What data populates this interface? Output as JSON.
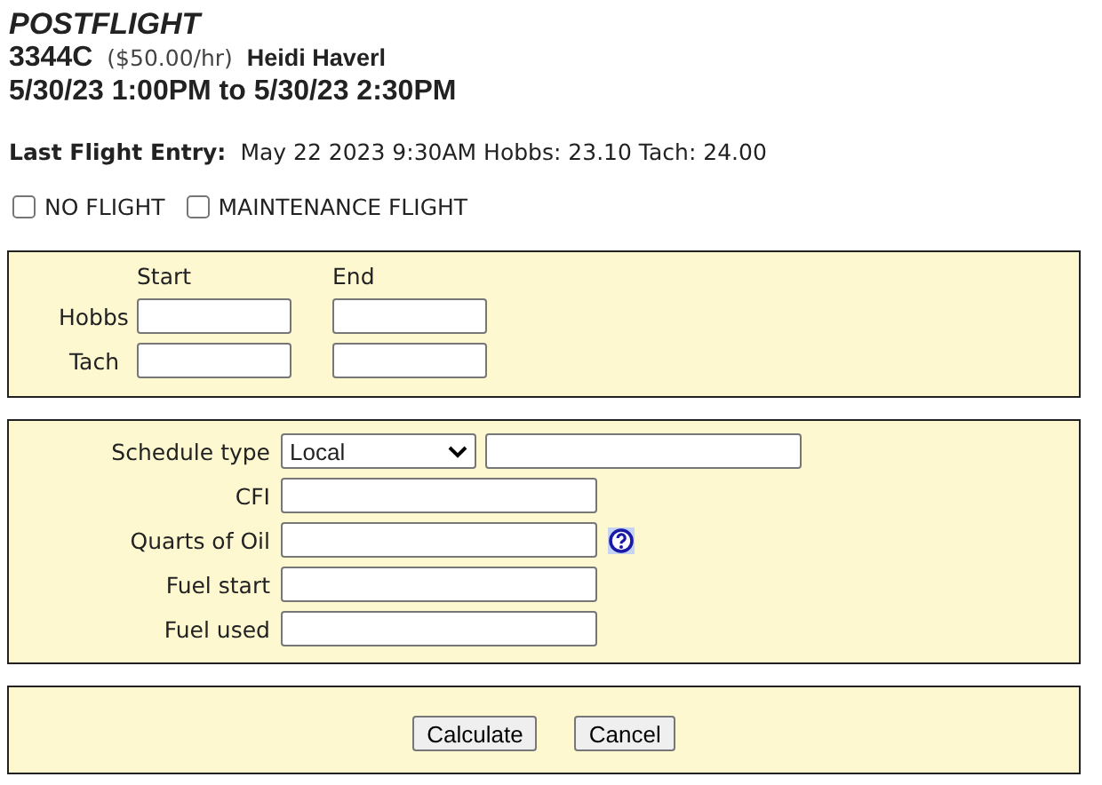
{
  "header": {
    "title": "POSTFLIGHT",
    "aircraft": "3344C",
    "rate": "($50.00/hr)",
    "pilot": "Heidi Haverl",
    "schedule": "5/30/23 1:00PM to 5/30/23 2:30PM"
  },
  "last_entry": {
    "label": "Last Flight Entry:",
    "value": "May 22 2023 9:30AM Hobbs: 23.10 Tach: 24.00"
  },
  "options": [
    {
      "label": "NO FLIGHT",
      "checked": false
    },
    {
      "label": "MAINTENANCE FLIGHT",
      "checked": false
    }
  ],
  "meters": {
    "columns": [
      "Start",
      "End"
    ],
    "rows": [
      {
        "label": "Hobbs"
      },
      {
        "label": "Tach"
      }
    ]
  },
  "details": [
    {
      "label": "Schedule type",
      "kind": "select",
      "value": "Local"
    },
    {
      "label": "CFI",
      "kind": "text"
    },
    {
      "label": "Quarts of Oil",
      "kind": "help"
    },
    {
      "label": "Fuel start",
      "kind": "text"
    },
    {
      "label": "Fuel used",
      "kind": "text"
    }
  ],
  "buttons": [
    "Calculate",
    "Cancel"
  ]
}
